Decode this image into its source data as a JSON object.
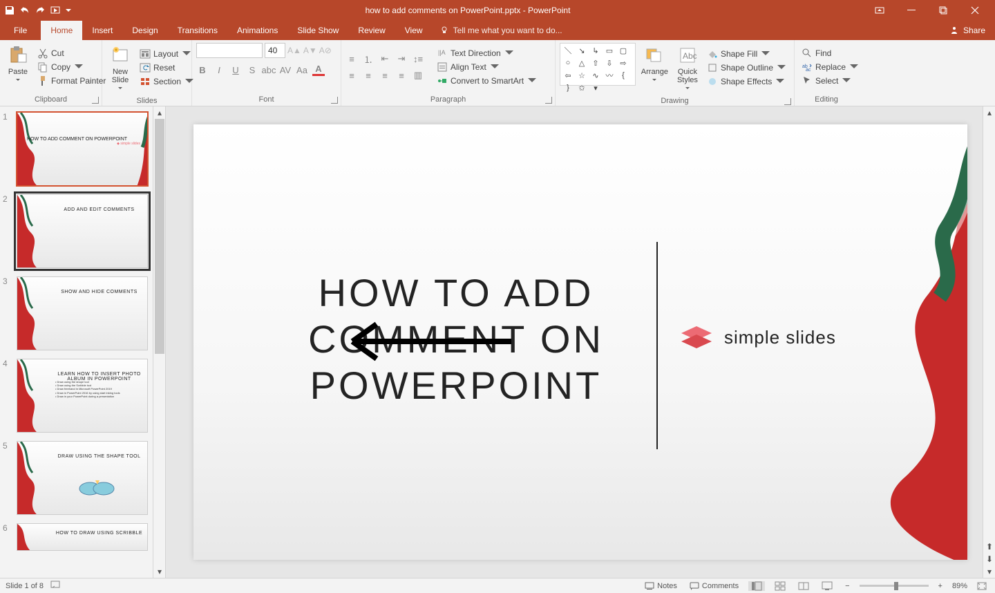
{
  "app": {
    "doc_title": "how to add comments on PowerPoint.pptx - PowerPoint"
  },
  "tabs": {
    "file": "File",
    "home": "Home",
    "insert": "Insert",
    "design": "Design",
    "transitions": "Transitions",
    "animations": "Animations",
    "slideshow": "Slide Show",
    "review": "Review",
    "view": "View",
    "tell_me": "Tell me what you want to do...",
    "share": "Share"
  },
  "ribbon": {
    "clipboard": {
      "label": "Clipboard",
      "paste": "Paste",
      "cut": "Cut",
      "copy": "Copy",
      "format_painter": "Format Painter"
    },
    "slides": {
      "label": "Slides",
      "new_slide": "New\nSlide",
      "layout": "Layout",
      "reset": "Reset",
      "section": "Section"
    },
    "font": {
      "label": "Font",
      "name": "",
      "size": "40"
    },
    "paragraph": {
      "label": "Paragraph",
      "text_direction": "Text Direction",
      "align_text": "Align Text",
      "convert_smartart": "Convert to SmartArt"
    },
    "drawing": {
      "label": "Drawing",
      "arrange": "Arrange",
      "quick_styles": "Quick\nStyles",
      "shape_fill": "Shape Fill",
      "shape_outline": "Shape Outline",
      "shape_effects": "Shape Effects"
    },
    "editing": {
      "label": "Editing",
      "find": "Find",
      "replace": "Replace",
      "select": "Select"
    }
  },
  "thumbnails": [
    {
      "n": "1",
      "title": "HOW TO ADD COMMENT ON POWERPOINT",
      "current": true,
      "logo": "simple slides"
    },
    {
      "n": "2",
      "title": "ADD AND EDIT COMMENTS",
      "selected": true
    },
    {
      "n": "3",
      "title": "SHOW AND HIDE COMMENTS"
    },
    {
      "n": "4",
      "title": "LEARN HOW TO INSERT PHOTO ALBUM IN POWERPOINT",
      "body": "• Draw using the shape tool\n• Draw using the Scribble tool\n• Draw freehand in Microsoft PowerPoint 2019\n• Draw in PowerPoint 2016 by using start inking tools\n• Draw in your PowerPoint during a presentation"
    },
    {
      "n": "5",
      "title": "DRAW USING THE SHAPE TOOL"
    },
    {
      "n": "6",
      "title": "HOW TO DRAW USING SCRIBBLE"
    }
  ],
  "slide": {
    "title_l1": "HOW TO ADD",
    "title_l2": "COMMENT ON",
    "title_l3": "POWERPOINT",
    "logo_text": "simple slides"
  },
  "status": {
    "slide_count": "Slide 1 of 8",
    "notes": "Notes",
    "comments": "Comments",
    "zoom": "89%"
  }
}
